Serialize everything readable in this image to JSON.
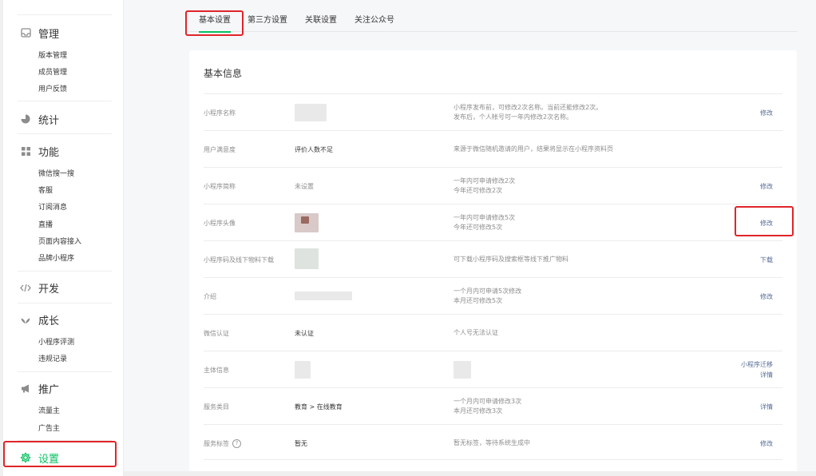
{
  "sidebar": {
    "manage": {
      "label": "管理",
      "icon": "inbox-icon"
    },
    "manage_items": [
      "版本管理",
      "成员管理",
      "用户反馈"
    ],
    "stats": {
      "label": "统计",
      "icon": "pie-chart-icon"
    },
    "features": {
      "label": "功能",
      "icon": "grid-icon"
    },
    "feature_items": [
      "微信搜一搜",
      "客服",
      "订阅消息",
      "直播",
      "页面内容接入",
      "品牌小程序"
    ],
    "dev": {
      "label": "开发",
      "icon": "code-icon"
    },
    "growth": {
      "label": "成长",
      "icon": "leaf-icon"
    },
    "growth_items": [
      "小程序评测",
      "违规记录"
    ],
    "promote": {
      "label": "推广",
      "icon": "megaphone-icon"
    },
    "promote_items": [
      "流量主",
      "广告主"
    ],
    "settings": {
      "label": "设置",
      "icon": "gear-icon"
    }
  },
  "tabs": [
    "基本设置",
    "第三方设置",
    "关联设置",
    "关注公众号"
  ],
  "active_tab": "基本设置",
  "card": {
    "title": "基本信息",
    "rows": [
      {
        "label": "小程序名称",
        "value": "",
        "desc": [
          "小程序发布前，可修改2次名称。当前还能修改2次。",
          "发布后，个人帐号可一年内修改2次名称。"
        ],
        "actions": [
          "修改"
        ]
      },
      {
        "label": "用户满意度",
        "value": "评价人数不足",
        "desc": [
          "来源于微信随机邀请的用户，结果将显示在小程序资料页"
        ],
        "actions": []
      },
      {
        "label": "小程序简称",
        "value": "未设置",
        "desc": [
          "一年内可申请修改2次",
          "今年还可修改2次"
        ],
        "actions": [
          "修改"
        ]
      },
      {
        "label": "小程序头像",
        "value": "",
        "desc": [
          "一年内可申请修改5次",
          "今年还可修改5次"
        ],
        "actions": [
          "修改"
        ]
      },
      {
        "label": "小程序码及线下物料下载",
        "value": "",
        "desc": [
          "可下载小程序码及搜索框等线下推广物料"
        ],
        "actions": [
          "下载"
        ]
      },
      {
        "label": "介绍",
        "value": "",
        "desc": [
          "一个月内可申请5次修改",
          "本月还可修改5次"
        ],
        "actions": [
          "修改"
        ]
      },
      {
        "label": "微信认证",
        "value": "未认证",
        "desc": [
          "个人号无法认证"
        ],
        "actions": []
      },
      {
        "label": "主体信息",
        "value": "",
        "desc": [
          ""
        ],
        "actions": [
          "小程序迁移",
          "详情"
        ]
      },
      {
        "label": "服务类目",
        "value": "教育 > 在线教育",
        "desc": [
          "一个月内可申请修改3次",
          "本月还可修改3次"
        ],
        "actions": [
          "详情"
        ]
      },
      {
        "label": "服务标签",
        "value": "暂无",
        "desc": [
          "暂无标签，等待系统生成中"
        ],
        "actions": [
          "修改"
        ]
      }
    ],
    "help_symbol": "?"
  },
  "colors": {
    "accent": "#07c160",
    "link": "#576b95",
    "highlight": "#e0242a"
  }
}
